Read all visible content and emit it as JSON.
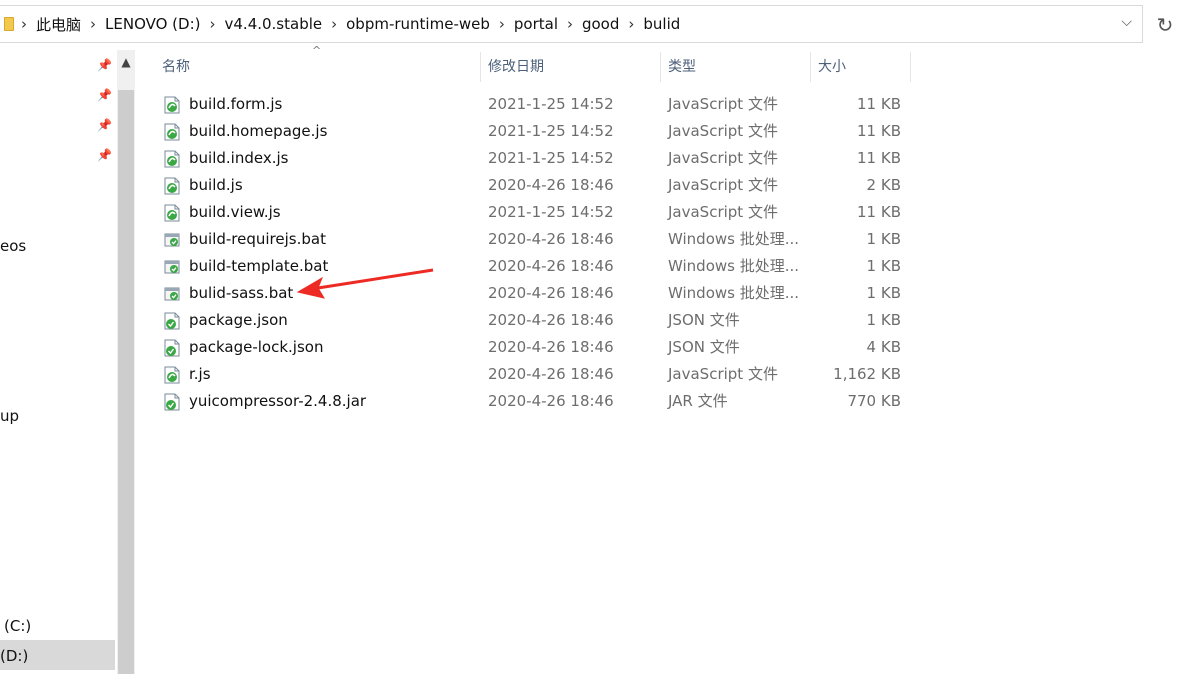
{
  "address": {
    "crumbs": [
      "此电脑",
      "LENOVO (D:)",
      "v4.4.0.stable",
      "obpm-runtime-web",
      "portal",
      "good",
      "bulid"
    ],
    "dropdown_icon": "chevron-down-icon",
    "refresh_icon": "refresh-icon"
  },
  "nav": {
    "partial_items": [
      "eos",
      "up",
      "(C:)",
      "(D:)"
    ]
  },
  "columns": {
    "name": "名称",
    "date": "修改日期",
    "type": "类型",
    "size": "大小"
  },
  "files": [
    {
      "name": "build.form.js",
      "date": "2021-1-25 14:52",
      "type": "JavaScript 文件",
      "size": "11 KB",
      "icon": "js"
    },
    {
      "name": "build.homepage.js",
      "date": "2021-1-25 14:52",
      "type": "JavaScript 文件",
      "size": "11 KB",
      "icon": "js"
    },
    {
      "name": "build.index.js",
      "date": "2021-1-25 14:52",
      "type": "JavaScript 文件",
      "size": "11 KB",
      "icon": "js"
    },
    {
      "name": "build.js",
      "date": "2020-4-26 18:46",
      "type": "JavaScript 文件",
      "size": "2 KB",
      "icon": "js"
    },
    {
      "name": "build.view.js",
      "date": "2021-1-25 14:52",
      "type": "JavaScript 文件",
      "size": "11 KB",
      "icon": "js"
    },
    {
      "name": "build-requirejs.bat",
      "date": "2020-4-26 18:46",
      "type": "Windows 批处理...",
      "size": "1 KB",
      "icon": "bat"
    },
    {
      "name": "build-template.bat",
      "date": "2020-4-26 18:46",
      "type": "Windows 批处理...",
      "size": "1 KB",
      "icon": "bat"
    },
    {
      "name": "bulid-sass.bat",
      "date": "2020-4-26 18:46",
      "type": "Windows 批处理...",
      "size": "1 KB",
      "icon": "bat"
    },
    {
      "name": "package.json",
      "date": "2020-4-26 18:46",
      "type": "JSON 文件",
      "size": "1 KB",
      "icon": "generic"
    },
    {
      "name": "package-lock.json",
      "date": "2020-4-26 18:46",
      "type": "JSON 文件",
      "size": "4 KB",
      "icon": "generic"
    },
    {
      "name": "r.js",
      "date": "2020-4-26 18:46",
      "type": "JavaScript 文件",
      "size": "1,162 KB",
      "icon": "js"
    },
    {
      "name": "yuicompressor-2.4.8.jar",
      "date": "2020-4-26 18:46",
      "type": "JAR 文件",
      "size": "770 KB",
      "icon": "generic"
    }
  ],
  "annotation": {
    "color": "#ee2a24",
    "points_to": "bulid-sass.bat"
  }
}
